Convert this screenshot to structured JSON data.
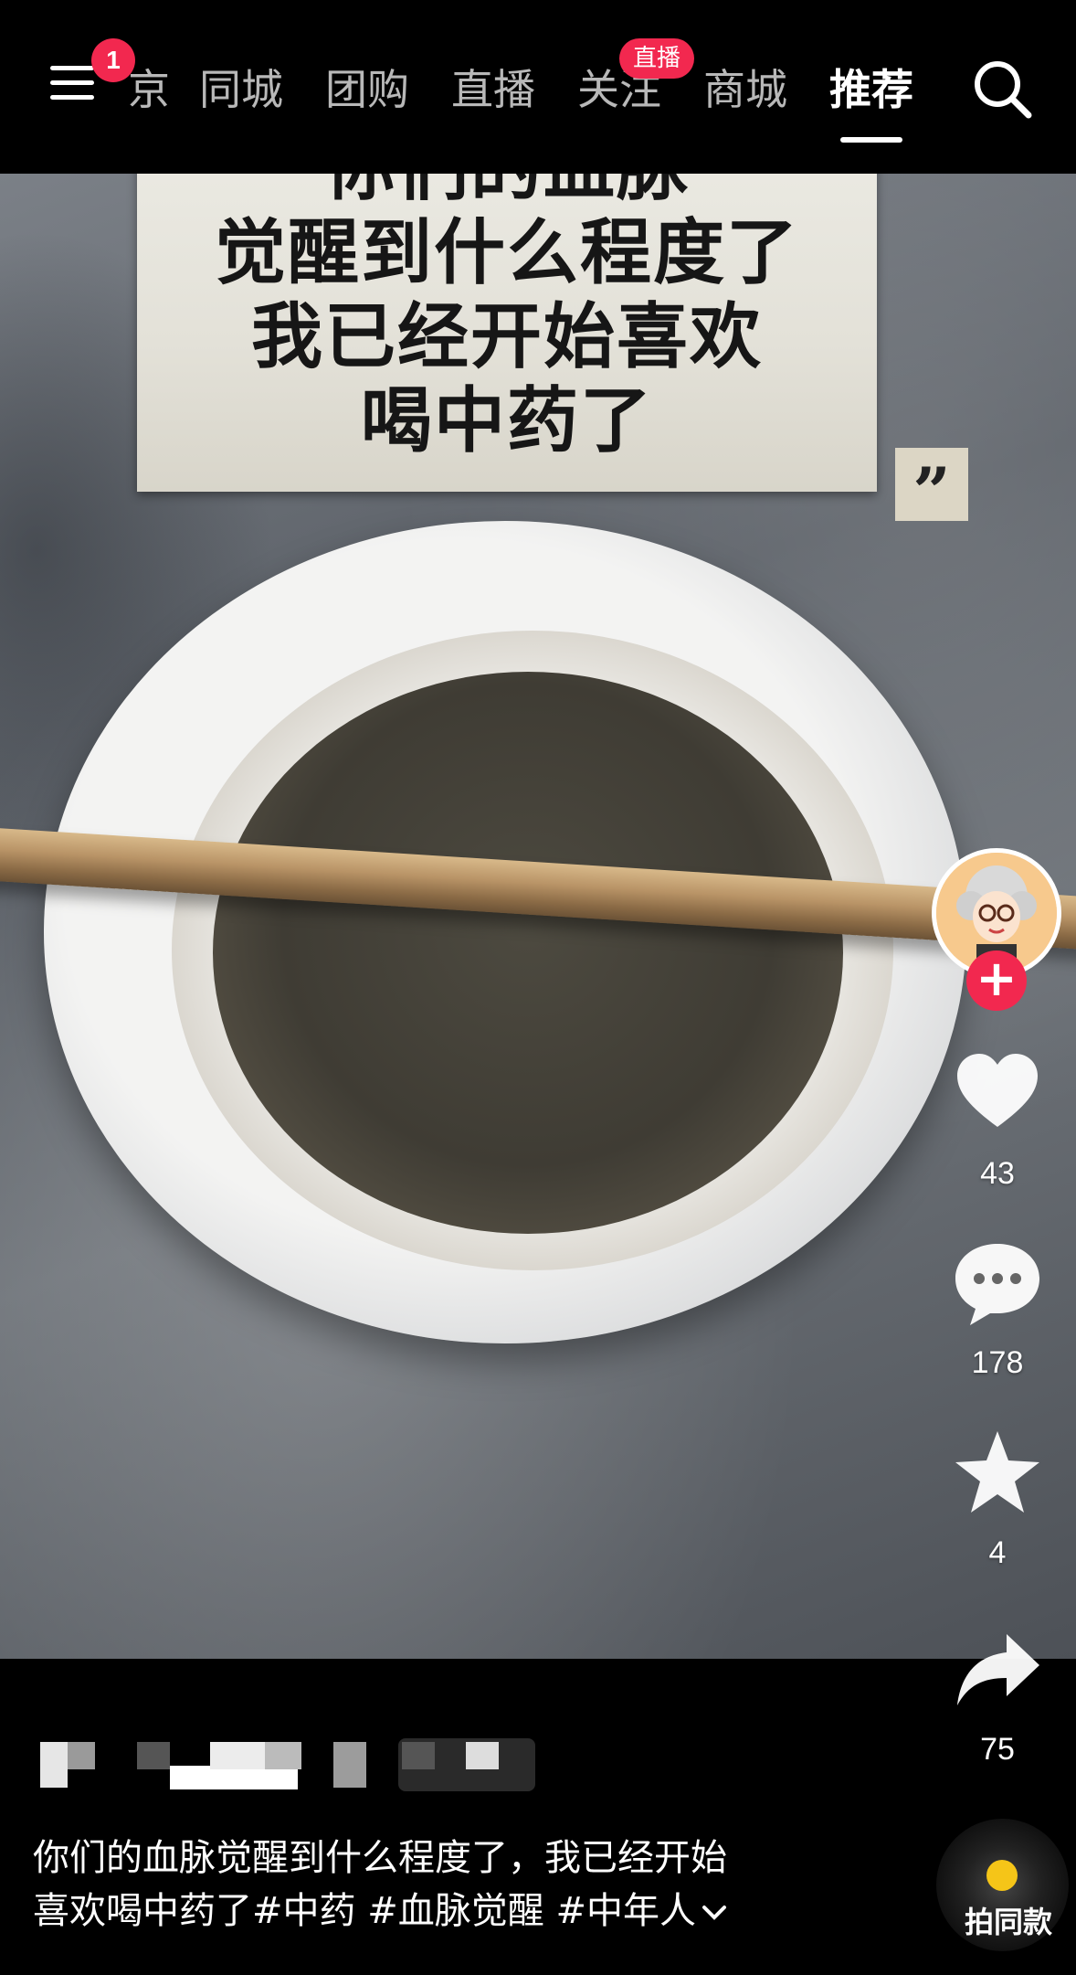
{
  "nav": {
    "notification_count": "1",
    "tabs": [
      {
        "label": "京",
        "active": false
      },
      {
        "label": "同城",
        "active": false
      },
      {
        "label": "团购",
        "active": false
      },
      {
        "label": "直播",
        "active": false
      },
      {
        "label": "关注",
        "active": false
      },
      {
        "label": "商城",
        "active": false
      },
      {
        "label": "推荐",
        "active": true
      }
    ],
    "live_badge": "直播"
  },
  "video": {
    "quote_lines": [
      "你们的血脉",
      "觉醒到什么程度了",
      "我已经开始喜欢",
      "喝中药了"
    ],
    "quote_open": "“",
    "quote_close": "”"
  },
  "actions": {
    "follow": "+",
    "likes": "43",
    "comments": "178",
    "favorites": "4",
    "shares": "75"
  },
  "post": {
    "description_line1": "你们的血脉觉醒到什么程度了，我已经开始",
    "description_line2": "喜欢喝中药了#中药 #血脉觉醒 #中年人",
    "same_style_label": "拍同款"
  },
  "colors": {
    "accent": "#f2284f",
    "background": "#000000",
    "disc_dot": "#f5c518"
  },
  "icons": [
    "menu-icon",
    "search-icon",
    "heart-icon",
    "comment-icon",
    "star-icon",
    "share-icon",
    "chevron-down-icon",
    "music-disc-icon"
  ]
}
